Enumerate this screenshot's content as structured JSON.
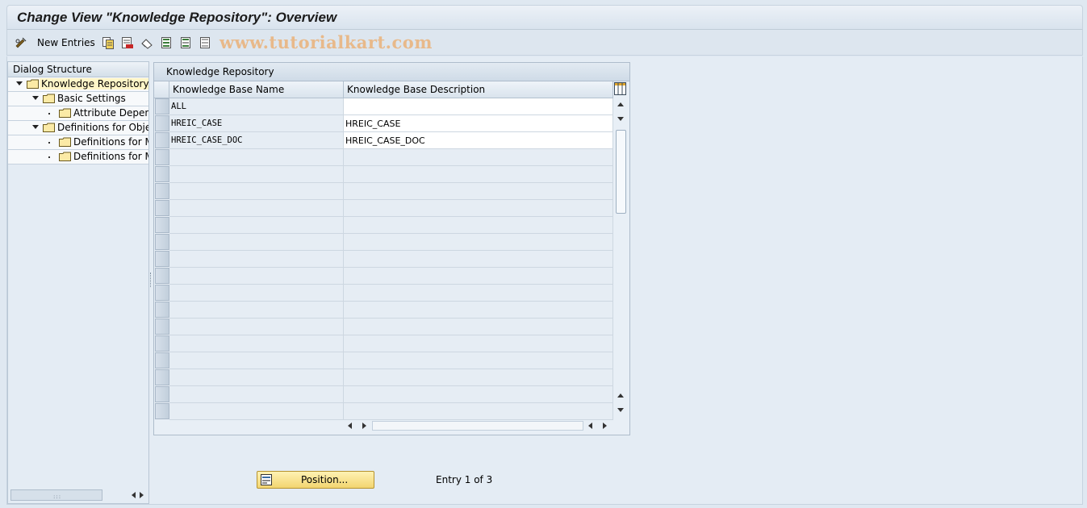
{
  "window": {
    "title": "Change View \"Knowledge Repository\": Overview"
  },
  "toolbar": {
    "new_entries_label": "New Entries",
    "watermark": "www.tutorialkart.com",
    "icons": [
      "edit-glasses-icon",
      "copy-as-icon",
      "delete-icon",
      "undo-change-icon",
      "select-all-icon",
      "select-block-icon",
      "deselect-all-icon"
    ]
  },
  "dialog_structure": {
    "title": "Dialog Structure",
    "items": [
      {
        "label": "Knowledge Repository",
        "level": 0,
        "expanded": true,
        "selected": true
      },
      {
        "label": "Basic Settings",
        "level": 1,
        "expanded": true
      },
      {
        "label": "Attribute Depend",
        "level": 2
      },
      {
        "label": "Definitions for Object",
        "level": 1,
        "expanded": true
      },
      {
        "label": "Definitions for Mo",
        "level": 2
      },
      {
        "label": "Definitions for Me",
        "level": 2
      }
    ]
  },
  "table": {
    "title": "Knowledge Repository",
    "columns": [
      "Knowledge Base Name",
      "Knowledge Base Description"
    ],
    "rows": [
      {
        "name": "ALL",
        "description": ""
      },
      {
        "name": "HREIC_CASE",
        "description": "HREIC_CASE"
      },
      {
        "name": "HREIC_CASE_DOC",
        "description": "HREIC_CASE_DOC"
      }
    ],
    "empty_rows": 16
  },
  "footer": {
    "position_button": "Position...",
    "entry_text": "Entry 1 of 3"
  },
  "colors": {
    "selected_tree_item": "#fff6c8",
    "button_yellow": "#f2d570",
    "background": "#dfe8f1"
  }
}
